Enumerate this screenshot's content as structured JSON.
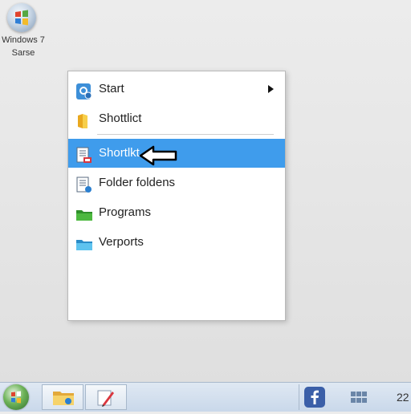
{
  "desktop": {
    "icon_line1": "Windows 7",
    "icon_line2": "Sarse",
    "icon_name": "windows-logo-icon"
  },
  "menu": {
    "items": [
      {
        "label": "Start",
        "icon": "start-app-icon",
        "has_submenu": true
      },
      {
        "label": "Shottlict",
        "icon": "folder-icon"
      },
      {
        "label": "Shortlkt",
        "icon": "document-shortcut-icon",
        "selected": true
      },
      {
        "label": "Folder foldens",
        "icon": "document-shortcut-icon"
      },
      {
        "label": "Programs",
        "icon": "green-folder-icon"
      },
      {
        "label": "Verports",
        "icon": "blue-folder-icon"
      }
    ],
    "selection_color": "#3f9cec"
  },
  "taskbar": {
    "start_icon": "start-orb-icon",
    "pinned": [
      "file-explorer-icon",
      "paint-icon"
    ],
    "tray": [
      "facebook-icon",
      "windows-grid-icon"
    ],
    "clock": "22"
  }
}
